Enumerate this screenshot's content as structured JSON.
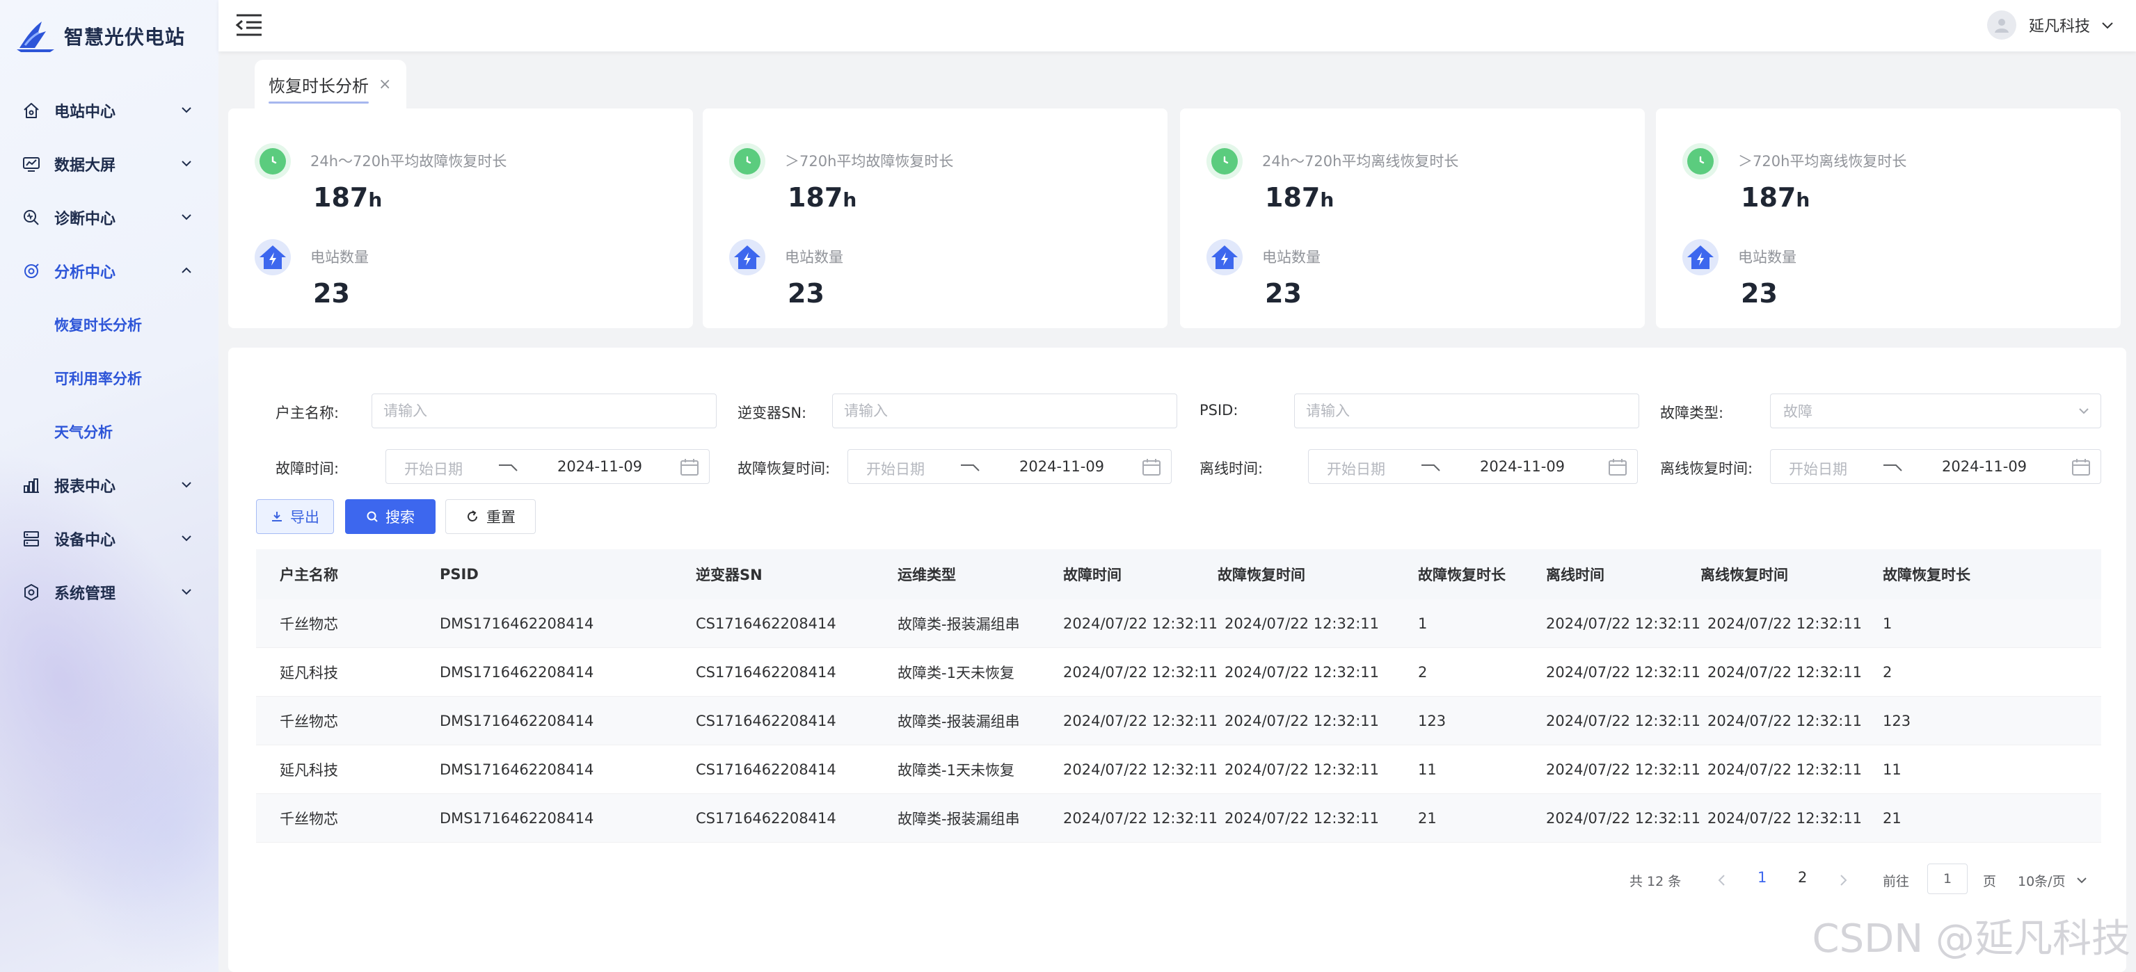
{
  "app": {
    "title": "智慧光伏电站"
  },
  "sidebar": {
    "items": [
      {
        "label": "电站中心",
        "icon": "home-icon",
        "expanded": false
      },
      {
        "label": "数据大屏",
        "icon": "monitor-icon",
        "expanded": false
      },
      {
        "label": "诊断中心",
        "icon": "diagnose-icon",
        "expanded": false
      },
      {
        "label": "分析中心",
        "icon": "analysis-icon",
        "expanded": true,
        "children": [
          {
            "label": "恢复时长分析",
            "active": true
          },
          {
            "label": "可利用率分析"
          },
          {
            "label": "天气分析"
          }
        ]
      },
      {
        "label": "报表中心",
        "icon": "report-icon",
        "expanded": false
      },
      {
        "label": "设备中心",
        "icon": "device-icon",
        "expanded": false
      },
      {
        "label": "系统管理",
        "icon": "settings-icon",
        "expanded": false
      }
    ]
  },
  "header": {
    "user_name": "延凡科技"
  },
  "tabs": [
    {
      "label": "恢复时长分析",
      "close": "×"
    }
  ],
  "cards": [
    {
      "metric_label": "24h～720h平均故障恢复时长",
      "metric_value": "187",
      "unit": "h",
      "count_label": "电站数量",
      "count_value": "23"
    },
    {
      "metric_label": "＞720h平均故障恢复时长",
      "metric_value": "187",
      "unit": "h",
      "count_label": "电站数量",
      "count_value": "23"
    },
    {
      "metric_label": "24h～720h平均离线恢复时长",
      "metric_value": "187",
      "unit": "h",
      "count_label": "电站数量",
      "count_value": "23"
    },
    {
      "metric_label": "＞720h平均离线恢复时长",
      "metric_value": "187",
      "unit": "h",
      "count_label": "电站数量",
      "count_value": "23"
    }
  ],
  "filters": {
    "owner": {
      "label": "户主名称:",
      "placeholder": "请输入"
    },
    "inverter_sn": {
      "label": "逆变器SN:",
      "placeholder": "请输入"
    },
    "psid": {
      "label": "PSID:",
      "placeholder": "请输入"
    },
    "fault_type": {
      "label": "故障类型:",
      "placeholder": "故障"
    },
    "fault_time": {
      "label": "故障时间:",
      "start": "开始日期",
      "end": "2024-11-09"
    },
    "fault_recover_time": {
      "label": "故障恢复时间:",
      "start": "开始日期",
      "end": "2024-11-09"
    },
    "offline_time": {
      "label": "离线时间:",
      "start": "开始日期",
      "end": "2024-11-09"
    },
    "offline_recover_time": {
      "label": "离线恢复时间:",
      "start": "开始日期",
      "end": "2024-11-09"
    }
  },
  "buttons": {
    "export": "导出",
    "search": "搜索",
    "reset": "重置"
  },
  "table": {
    "columns": [
      "户主名称",
      "PSID",
      "逆变器SN",
      "运维类型",
      "故障时间",
      "故障恢复时间",
      "故障恢复时长",
      "离线时间",
      "离线恢复时间",
      "故障恢复时长"
    ],
    "rows": [
      [
        "千丝物芯",
        "DMS1716462208414",
        "CS1716462208414",
        "故障类-报装漏组串",
        "2024/07/22 12:32:11",
        "2024/07/22 12:32:11",
        "1",
        "2024/07/22 12:32:11",
        "2024/07/22 12:32:11",
        "1"
      ],
      [
        "延凡科技",
        "DMS1716462208414",
        "CS1716462208414",
        "故障类-1天未恢复",
        "2024/07/22 12:32:11",
        "2024/07/22 12:32:11",
        "2",
        "2024/07/22 12:32:11",
        "2024/07/22 12:32:11",
        "2"
      ],
      [
        "千丝物芯",
        "DMS1716462208414",
        "CS1716462208414",
        "故障类-报装漏组串",
        "2024/07/22 12:32:11",
        "2024/07/22 12:32:11",
        "123",
        "2024/07/22 12:32:11",
        "2024/07/22 12:32:11",
        "123"
      ],
      [
        "延凡科技",
        "DMS1716462208414",
        "CS1716462208414",
        "故障类-1天未恢复",
        "2024/07/22 12:32:11",
        "2024/07/22 12:32:11",
        "11",
        "2024/07/22 12:32:11",
        "2024/07/22 12:32:11",
        "11"
      ],
      [
        "千丝物芯",
        "DMS1716462208414",
        "CS1716462208414",
        "故障类-报装漏组串",
        "2024/07/22 12:32:11",
        "2024/07/22 12:32:11",
        "21",
        "2024/07/22 12:32:11",
        "2024/07/22 12:32:11",
        "21"
      ]
    ]
  },
  "pagination": {
    "total_text": "共 12 条",
    "pages": [
      "1",
      "2"
    ],
    "current_page": "1",
    "goto_label": "前往",
    "goto_value": "1",
    "page_suffix": "页",
    "page_size": "10条/页"
  },
  "watermark": "CSDN @延凡科技",
  "colors": {
    "primary": "#3d67ee",
    "active_menu": "#2d55d8",
    "clock_green": "#5bcc7e",
    "house_blue": "#3d67ee"
  }
}
